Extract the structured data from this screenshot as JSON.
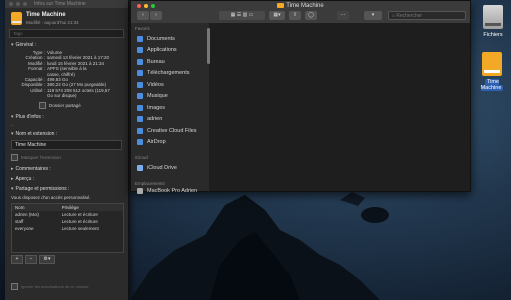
{
  "info": {
    "window_title": "Infos sur Time Machine",
    "name": "Time Machine",
    "modified": "Modifié : aujourd'hui 21:34",
    "tags_placeholder": "Tags",
    "general_label": "Général :",
    "rows": [
      {
        "k": "Type :",
        "v": "Volume"
      },
      {
        "k": "Création :",
        "v": "samedi 13 février 2021 à 17:20"
      },
      {
        "k": "Modifié :",
        "v": "lundi 15 février 2021 à 21:34"
      },
      {
        "k": "Format :",
        "v": "APFS (sensible à la"
      },
      {
        "k": "",
        "v": "casse, chiffré)"
      },
      {
        "k": "Capacité :",
        "v": "499,83 Go"
      },
      {
        "k": "Disponible :",
        "v": "380,22 Go (27 Mo purgeable)"
      },
      {
        "k": "Utilisé :",
        "v": "119 574 208 512 octets (119,57"
      },
      {
        "k": "",
        "v": "Go sur disque)"
      }
    ],
    "shared_folder": "Dossier partagé",
    "more_info": "Plus d'infos :",
    "dash": "--",
    "name_ext": "Nom et extension :",
    "name_value": "Time Machine",
    "hide_ext": "Masquer l'extension",
    "comments": "Commentaires :",
    "preview": "Aperçu :",
    "sharing": "Partage et permissions :",
    "sharing_desc": "Vous disposez d'un accès personnalisé.",
    "perm_headers": {
      "name": "Nom",
      "priv": "Privilège"
    },
    "perm_rows": [
      {
        "name": "adrien (Moi)",
        "priv": "Lecture et écriture"
      },
      {
        "name": "staff",
        "priv": "Lecture et écriture"
      },
      {
        "name": "everyone",
        "priv": "Lecture seulement"
      }
    ],
    "add": "+",
    "remove": "−",
    "action": "⚙▾",
    "ignore": "Ignorer les autorisations de ce volume"
  },
  "finder": {
    "title": "Time Machine",
    "search_placeholder": "Rechercher",
    "sections": {
      "fav": "Favoris",
      "icloud": "iCloud",
      "places": "Emplacements"
    },
    "favorites": [
      {
        "label": "Documents",
        "icon": "document-icon"
      },
      {
        "label": "Applications",
        "icon": "applications-icon"
      },
      {
        "label": "Bureau",
        "icon": "desktop-icon"
      },
      {
        "label": "Téléchargements",
        "icon": "download-icon"
      },
      {
        "label": "Vidéos",
        "icon": "video-icon"
      },
      {
        "label": "Musique",
        "icon": "music-icon"
      },
      {
        "label": "Images",
        "icon": "pictures-icon"
      },
      {
        "label": "adrien",
        "icon": "home-icon"
      },
      {
        "label": "Creative Cloud Files",
        "icon": "cloud-files-icon"
      },
      {
        "label": "AirDrop",
        "icon": "airdrop-icon"
      }
    ],
    "icloud_drive": "iCloud Drive",
    "places_item": "MacBook Pro Adrien"
  },
  "desktop": {
    "fichiers": "Fichiers",
    "time_machine": "Time Machine"
  }
}
